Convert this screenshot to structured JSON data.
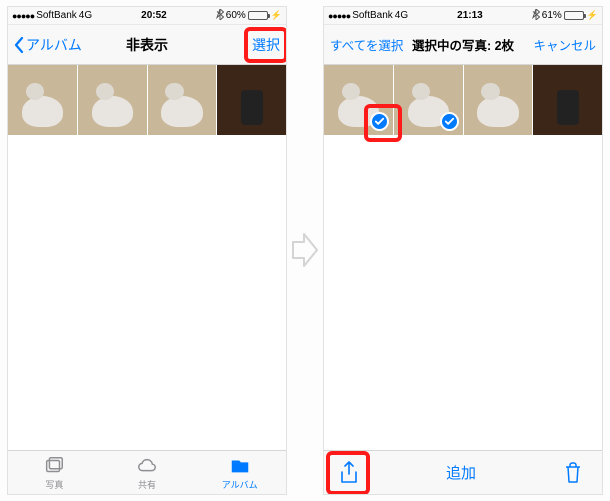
{
  "left": {
    "status": {
      "carrier": "SoftBank",
      "network": "4G",
      "time": "20:52",
      "battery_pct": "60%",
      "battery_fill": 60
    },
    "nav": {
      "back_label": "アルバム",
      "title": "非表示",
      "right_label": "選択"
    },
    "tabs": {
      "photos": "写真",
      "shared": "共有",
      "albums": "アルバム"
    }
  },
  "right": {
    "status": {
      "carrier": "SoftBank",
      "network": "4G",
      "time": "21:13",
      "battery_pct": "61%",
      "battery_fill": 61
    },
    "nav": {
      "left_label": "すべてを選択",
      "title": "選択中の写真: 2枚",
      "right_label": "キャンセル"
    },
    "toolbar": {
      "center_label": "追加"
    },
    "selected_thumbs": [
      true,
      true,
      false,
      false
    ]
  },
  "colors": {
    "ios_blue": "#007aff",
    "highlight_red": "#ff1a1a"
  }
}
